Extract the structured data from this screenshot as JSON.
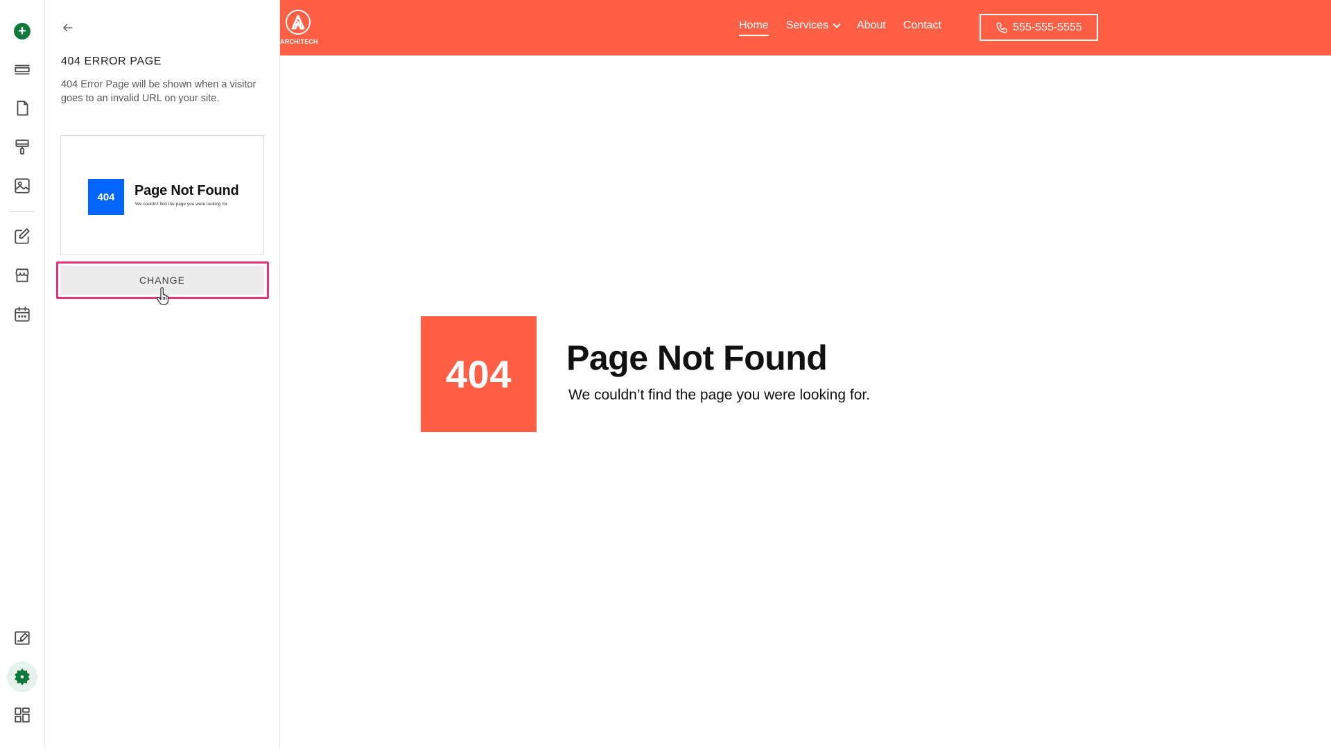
{
  "rail": {
    "items": [
      {
        "name": "add-icon"
      },
      {
        "name": "sections-icon"
      },
      {
        "name": "pages-icon"
      },
      {
        "name": "design-icon"
      },
      {
        "name": "media-icon"
      },
      {
        "name": "blog-icon"
      },
      {
        "name": "store-icon"
      },
      {
        "name": "calendar-icon"
      },
      {
        "name": "edit-site-icon"
      },
      {
        "name": "settings-icon"
      },
      {
        "name": "apps-icon"
      }
    ],
    "active": "settings-icon",
    "accent_color": "#0f7a3b"
  },
  "panel": {
    "title": "404 ERROR PAGE",
    "description": "404 Error Page will be shown when a visitor goes to an invalid URL on your site.",
    "preview": {
      "code": "404",
      "heading": "Page Not Found",
      "subtext": "We couldn't find the page you were looking for.",
      "box_color": "#0066ff"
    },
    "change_label": "CHANGE",
    "highlight_color": "#e8317a"
  },
  "site": {
    "brand_color": "#fe5f45",
    "logo_text": "ARCHITECH",
    "nav": [
      {
        "label": "Home",
        "active": true
      },
      {
        "label": "Services",
        "dropdown": true
      },
      {
        "label": "About"
      },
      {
        "label": "Contact"
      }
    ],
    "phone": "555-555-5555",
    "error_code": "404",
    "heading": "Page Not Found",
    "subtext": "We couldn’t find the page you were looking for."
  }
}
